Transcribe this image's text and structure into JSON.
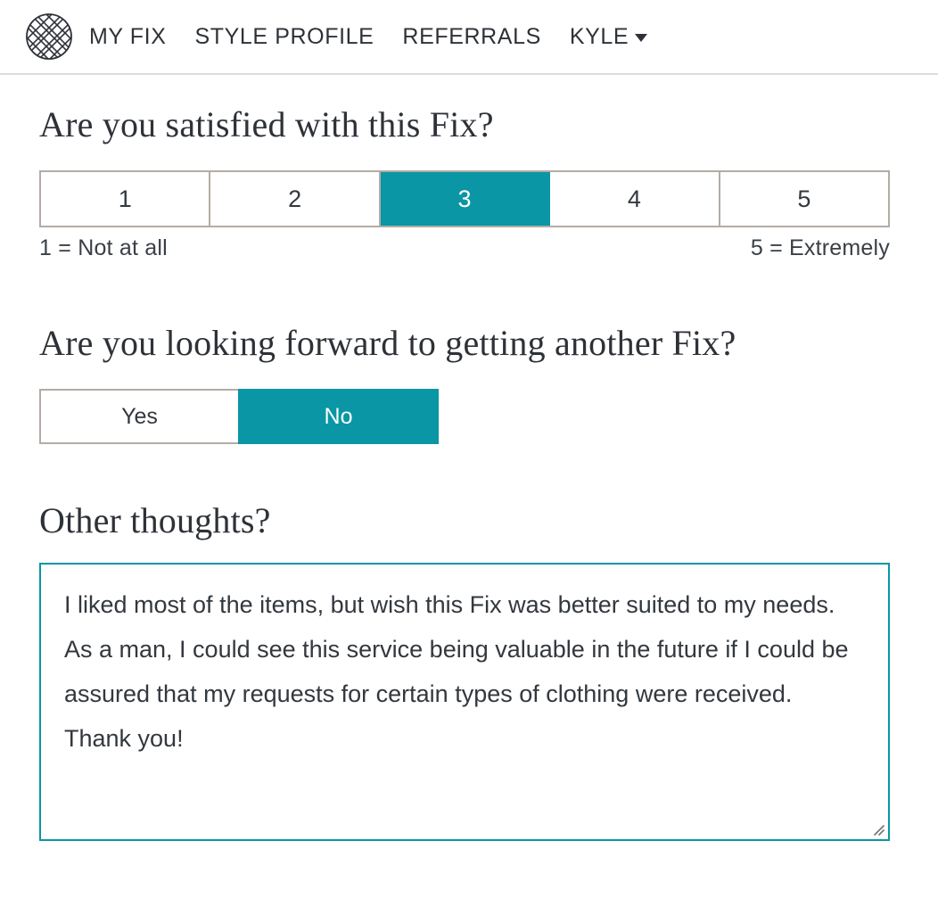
{
  "header": {
    "logo_icon": "stitch-fix-woven-circle-logo",
    "nav": [
      {
        "label": "MY FIX"
      },
      {
        "label": "STYLE PROFILE"
      },
      {
        "label": "REFERRALS"
      }
    ],
    "account": {
      "label": "KYLE",
      "caret_icon": "chevron-down-icon"
    }
  },
  "colors": {
    "accent_teal": "#0a96a4",
    "border_taupe": "#b3aca6",
    "text_dark": "#2e3238",
    "header_rule": "#dcdcdc"
  },
  "survey": {
    "satisfaction": {
      "question": "Are you satisfied with this Fix?",
      "options": [
        "1",
        "2",
        "3",
        "4",
        "5"
      ],
      "selected": "3",
      "legend_low": "1 = Not at all",
      "legend_high": "5 = Extremely"
    },
    "another_fix": {
      "question": "Are you looking forward to getting another Fix?",
      "options": [
        "Yes",
        "No"
      ],
      "selected": "No"
    },
    "other_thoughts": {
      "question": "Other thoughts?",
      "value": "I liked most of the items, but wish this Fix was better suited to my needs.  As a man, I could see this service being valuable in the future if I could be assured that my requests for certain types of clothing were received. Thank you!",
      "placeholder": ""
    }
  }
}
